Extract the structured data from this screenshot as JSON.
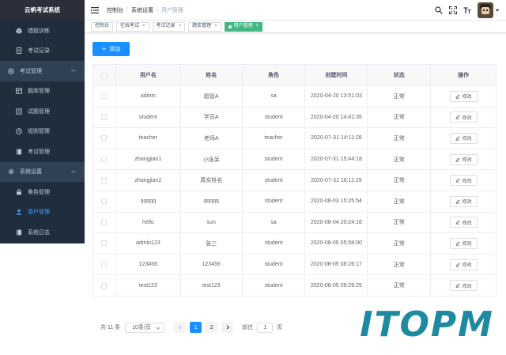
{
  "app": {
    "title": "云帆考试系统"
  },
  "sidebar": {
    "items": [
      {
        "label": "错题训练",
        "type": "sub",
        "icon": "cube-icon"
      },
      {
        "label": "考试记录",
        "type": "sub",
        "icon": "document-icon"
      },
      {
        "label": "考试管理",
        "type": "group",
        "icon": "sync-icon"
      },
      {
        "label": "题库管理",
        "type": "sub",
        "icon": "table-icon"
      },
      {
        "label": "试题管理",
        "type": "sub",
        "icon": "list-icon"
      },
      {
        "label": "规则管理",
        "type": "sub",
        "icon": "clock-icon"
      },
      {
        "label": "考试管理",
        "type": "sub",
        "icon": "book-icon"
      },
      {
        "label": "系统设置",
        "type": "group",
        "icon": "gear-icon"
      },
      {
        "label": "角色管理",
        "type": "sub",
        "icon": "lock-icon"
      },
      {
        "label": "用户管理",
        "type": "sub",
        "icon": "user-icon",
        "active": true
      },
      {
        "label": "系统日志",
        "type": "sub",
        "icon": "book-icon"
      }
    ]
  },
  "breadcrumb": [
    "控制台",
    "系统设置",
    "用户管理"
  ],
  "tags": [
    {
      "label": "控制台",
      "closable": false
    },
    {
      "label": "在线考试",
      "closable": true
    },
    {
      "label": "考试记录",
      "closable": true
    },
    {
      "label": "题库管理",
      "closable": true
    },
    {
      "label": "用户管理",
      "closable": true,
      "active": true
    }
  ],
  "toolbar": {
    "add_label": "添加"
  },
  "table": {
    "headers": [
      "用户名",
      "姓名",
      "角色",
      "创建时间",
      "状态",
      "操作"
    ],
    "rows": [
      {
        "username": "admin",
        "name": "超管A",
        "role": "sa",
        "created": "2020-04-20 13:51:03",
        "status": "正常"
      },
      {
        "username": "student",
        "name": "学员A",
        "role": "student",
        "created": "2020-04-20 14:41:35",
        "status": "正常"
      },
      {
        "username": "teacher",
        "name": "老师A",
        "role": "teacher",
        "created": "2020-07-31 14:11:28",
        "status": "正常"
      },
      {
        "username": "zhangjian1",
        "name": "小张呆",
        "role": "student",
        "created": "2020-07-31 15:44:18",
        "status": "正常"
      },
      {
        "username": "zhangjian2",
        "name": "真实姓名",
        "role": "student",
        "created": "2020-07-31 16:11:29",
        "status": "正常"
      },
      {
        "username": "qqqqq",
        "name": "qqqqq",
        "role": "student",
        "created": "2020-08-03 15:25:54",
        "status": "正常"
      },
      {
        "username": "hello",
        "name": "sun",
        "role": "sa",
        "created": "2020-08-04 20:24:16",
        "status": "正常"
      },
      {
        "username": "admin123",
        "name": "张三",
        "role": "student",
        "created": "2020-08-05 05:58:00",
        "status": "正常"
      },
      {
        "username": "123456",
        "name": "123456",
        "role": "student",
        "created": "2020-08-05 08:26:17",
        "status": "正常"
      },
      {
        "username": "test123",
        "name": "test123",
        "role": "student",
        "created": "2020-08-05 09:29:25",
        "status": "正常"
      }
    ],
    "edit_label": "修改"
  },
  "pagination": {
    "total": "共 11 条",
    "page_size": "10条/页",
    "pages": [
      "1",
      "2"
    ],
    "current": "1",
    "goto_prefix": "前往",
    "goto_value": "1",
    "goto_suffix": "页"
  },
  "watermark": {
    "text": "ITOPM"
  },
  "colors": {
    "sidebar_bg": "#304156",
    "primary": "#1890ff",
    "tag_active": "#42b983",
    "watermark": "#1d8aa0"
  }
}
